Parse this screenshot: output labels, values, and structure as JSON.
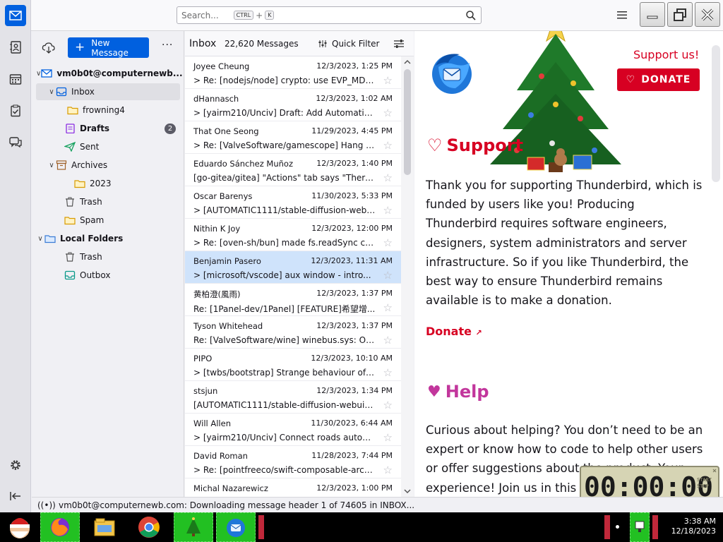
{
  "search": {
    "placeholder": "Search...",
    "kbd1": "CTRL",
    "plus": "+",
    "kbd2": "K"
  },
  "folders": {
    "get_messages": "Get Messages",
    "new_message": "New Message",
    "more": "···",
    "account": "vm0b0t@computernewb...",
    "inbox": "Inbox",
    "frowning4": "frowning4",
    "drafts": "Drafts",
    "drafts_count": "2",
    "sent": "Sent",
    "archives": "Archives",
    "year": "2023",
    "trash": "Trash",
    "spam": "Spam",
    "local_folders": "Local Folders",
    "local_trash": "Trash",
    "outbox": "Outbox"
  },
  "thread": {
    "title": "Inbox",
    "count": "22,620 Messages",
    "quick_filter": "Quick Filter",
    "messages": [
      {
        "sender": "Joyee Cheung",
        "date": "12/3/2023, 1:25 PM",
        "subject": "Re: [nodejs/node] crypto: use EVP_MD_f...",
        "thread": true,
        "selected": false
      },
      {
        "sender": "dHannasch",
        "date": "12/3/2023, 1:02 AM",
        "subject": "[yairm210/Unciv] Draft: Add Automaticall...",
        "thread": true,
        "selected": false
      },
      {
        "sender": "That One Seong",
        "date": "11/29/2023, 4:45 PM",
        "subject": "Re: [ValveSoftware/gamescope] Hang o...",
        "thread": true,
        "selected": false
      },
      {
        "sender": "Eduardo Sánchez Muñoz",
        "date": "12/3/2023, 1:40 PM",
        "subject": "[go-gitea/gitea] \"Actions\" tab says \"There ...",
        "thread": false,
        "selected": false
      },
      {
        "sender": "Oscar Barenys",
        "date": "11/30/2023, 5:33 PM",
        "subject": "[AUTOMATIC1111/stable-diffusion-webu...",
        "thread": true,
        "selected": false
      },
      {
        "sender": "Nithin K Joy",
        "date": "12/3/2023, 12:00 PM",
        "subject": "Re: [oven-sh/bun] made fs.readSync co...",
        "thread": true,
        "selected": false
      },
      {
        "sender": "Benjamin Pasero",
        "date": "12/3/2023, 11:31 AM",
        "subject": "[microsoft/vscode] aux window - intro...",
        "thread": true,
        "selected": true
      },
      {
        "sender": "黄柏澄(風雨)",
        "date": "12/3/2023, 1:37 PM",
        "subject": "Re: [1Panel-dev/1Panel] [FEATURE]希望增...",
        "thread": false,
        "selected": false
      },
      {
        "sender": "Tyson Whitehead",
        "date": "12/3/2023, 1:37 PM",
        "subject": "Re: [ValveSoftware/wine] winebus.sys: Only...",
        "thread": false,
        "selected": false
      },
      {
        "sender": "PIPO",
        "date": "12/3/2023, 10:10 AM",
        "subject": "[twbs/bootstrap] Strange behaviour of \"...",
        "thread": true,
        "selected": false
      },
      {
        "sender": "stsjun",
        "date": "12/3/2023, 1:34 PM",
        "subject": "[AUTOMATIC1111/stable-diffusion-webui] [...",
        "thread": false,
        "selected": false
      },
      {
        "sender": "Will Allen",
        "date": "11/30/2023, 6:44 AM",
        "subject": "[yairm210/Unciv] Connect roads automa...",
        "thread": true,
        "selected": false
      },
      {
        "sender": "David Roman",
        "date": "11/28/2023, 7:44 PM",
        "subject": "Re: [pointfreeco/swift-composable-archi...",
        "thread": true,
        "selected": false
      },
      {
        "sender": "Michal Nazarewicz",
        "date": "12/3/2023, 1:00 PM",
        "subject": "",
        "thread": false,
        "selected": false
      }
    ]
  },
  "content": {
    "support_us": "Support us!",
    "donate_button": "DONATE",
    "support_heading": "Support",
    "support_text": "Thank you for supporting Thunderbird, which is funded by users like you! Producing Thunderbird requires software engineers, designers, system administrators and server infrastructure. So if you like Thunderbird, the best way to ensure Thunderbird remains available is to make a donation.",
    "donate_link": "Donate",
    "help_heading": "Help",
    "help_text": "Curious about helping? You don’t need to be an expert or know how to code to help other users or offer suggestions about the product. Your experience! Join us in this c"
  },
  "timer": {
    "value": "00:00:00",
    "label": "START STOP"
  },
  "status": {
    "text": "vm0b0t@computernewb.com: Downloading message header 1 of 74605 in INBOX..."
  },
  "taskbar": {
    "time": "3:38 AM",
    "date": "12/18/2023"
  },
  "colors": {
    "accent": "#0060df",
    "donate_red": "#d70022",
    "help_pink": "#c2369c",
    "selection": "#cfe3fb"
  }
}
